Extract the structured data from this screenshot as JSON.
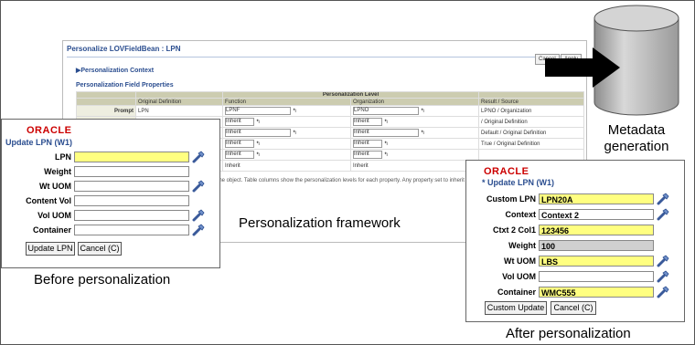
{
  "personalization_page": {
    "title": "Personalize LOVFieldBean : LPN",
    "cancel": "Cancel",
    "apply": "Apply",
    "context": "▶Personalization Context",
    "field_properties": "Personalization Field Properties",
    "level_header": "Personalization Level",
    "col_original": "Original Definition",
    "col_function": "Function",
    "col_organization": "Organization",
    "col_result": "Result / Source",
    "row_prompt": "Prompt",
    "prompt_original": "LPN",
    "prompt_function": "LPNF",
    "prompt_organization": "LPNO",
    "prompt_result": "LPNO / Organization",
    "inherit": "Inherit",
    "result_orig": "/ Original Definition",
    "result_default": "Default / Original Definition",
    "result_true": "True / Original Definition",
    "desc": "for the object. Table columns show the personalization levels for each property.  Any property set to inherit"
  },
  "before": {
    "logo": "ORACLE",
    "title": "Update LPN (W1)",
    "fields": [
      "LPN",
      "Weight",
      "Wt UOM",
      "Content Vol",
      "Vol UOM",
      "Container"
    ],
    "btn_update": "Update LPN",
    "btn_cancel": "Cancel (C)"
  },
  "after": {
    "logo": "ORACLE",
    "title": "* Update LPN (W1)",
    "fields": [
      {
        "label": "Custom LPN",
        "value": "LPN20A"
      },
      {
        "label": "Context",
        "value": "Context 2"
      },
      {
        "label": "Ctxt 2 Col1",
        "value": "123456"
      },
      {
        "label": "Weight",
        "value": "100"
      },
      {
        "label": "Wt UOM",
        "value": "LBS"
      },
      {
        "label": "Vol UOM",
        "value": ""
      },
      {
        "label": "Container",
        "value": "WMC555"
      }
    ],
    "btn_update": "Custom Update",
    "btn_cancel": "Cancel (C)"
  },
  "labels": {
    "metadata": "Metadata generation",
    "framework": "Personalization framework",
    "before": "Before personalization",
    "after": "After personalization"
  },
  "colors": {
    "field_highlight": "#ffff80",
    "cylinder": "#b8b8b8",
    "oracle_red": "#cc0000"
  }
}
